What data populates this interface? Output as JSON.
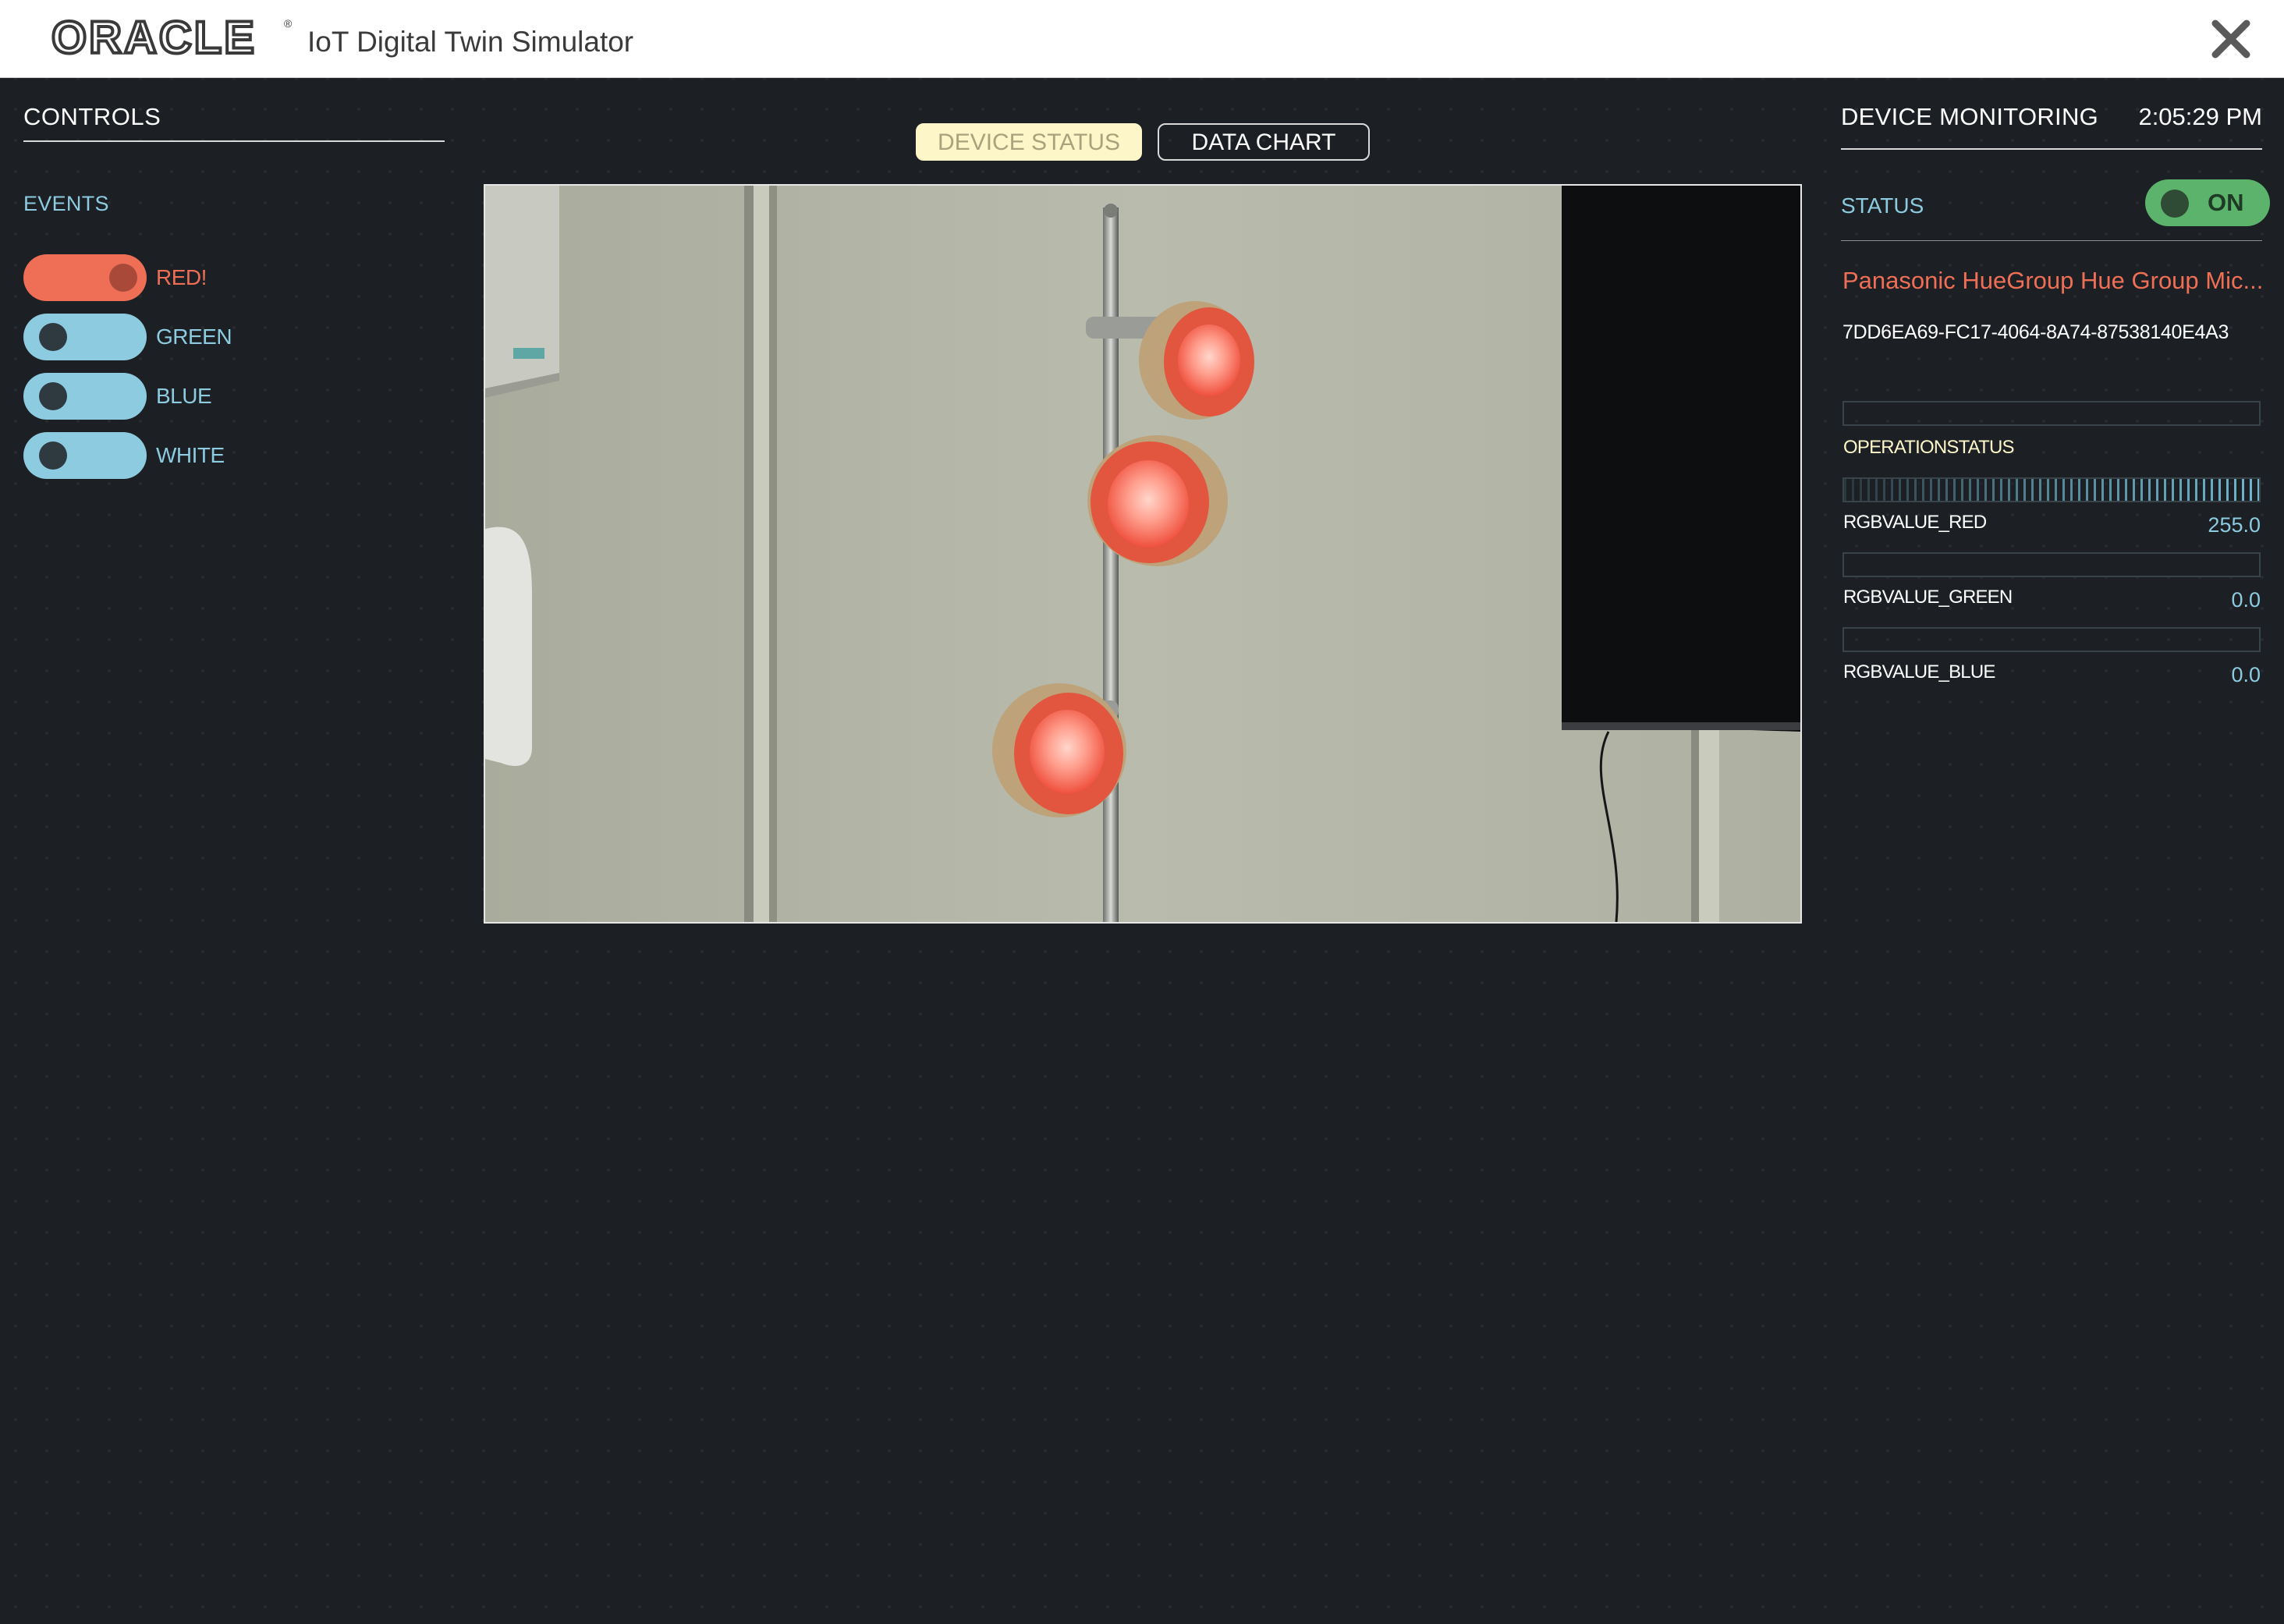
{
  "header": {
    "logo": "ORACLE",
    "title": "IoT Digital Twin Simulator"
  },
  "controls": {
    "title": "CONTROLS",
    "events_label": "EVENTS",
    "events": [
      {
        "label": "RED!",
        "active": true
      },
      {
        "label": "GREEN",
        "active": false
      },
      {
        "label": "BLUE",
        "active": false
      },
      {
        "label": "WHITE",
        "active": false
      }
    ]
  },
  "tabs": [
    {
      "label": "DEVICE STATUS",
      "selected": true
    },
    {
      "label": "DATA CHART",
      "selected": false
    }
  ],
  "monitoring": {
    "title": "DEVICE MONITORING",
    "time": "2:05:29 PM",
    "status_label": "STATUS",
    "status_value": "ON",
    "device_name": "Panasonic HueGroup Hue Group Mic...",
    "device_id": "7DD6EA69-FC17-4064-8A74-87538140E4A3",
    "metrics": [
      {
        "label": "OPERATIONSTATUS",
        "value": "",
        "level": 0
      },
      {
        "label": "RGBVALUE_RED",
        "value": "255.0",
        "level": 1.0
      },
      {
        "label": "RGBVALUE_GREEN",
        "value": "0.0",
        "level": 0
      },
      {
        "label": "RGBVALUE_BLUE",
        "value": "0.0",
        "level": 0
      }
    ]
  },
  "colors": {
    "background": "#1c2024",
    "accent_blue": "#8ccbe0",
    "accent_red": "#ee6f56",
    "status_green": "#5cb46c",
    "tab_active": "#fcf6c8"
  },
  "icons": {
    "close": "close-icon",
    "camera": "camera-feed"
  }
}
